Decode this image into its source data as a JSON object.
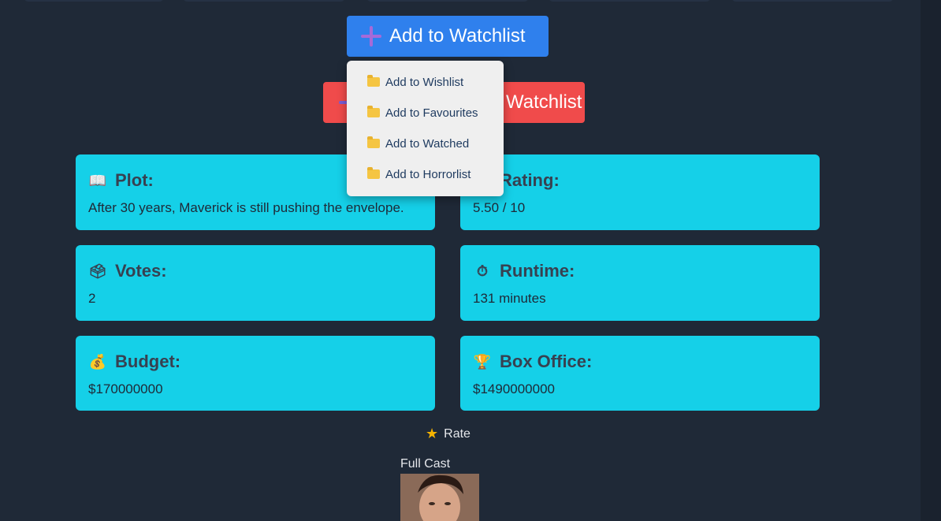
{
  "buttons": {
    "add_watchlist": "Add to Watchlist",
    "remove_watchlist": "Watchlist"
  },
  "menu": {
    "items": [
      {
        "label": "Add to Wishlist",
        "icon": "folder-icon"
      },
      {
        "label": "Add to Favourites",
        "icon": "folder-icon"
      },
      {
        "label": "Add to Watched",
        "icon": "folder-icon"
      },
      {
        "label": "Add to Horrorlist",
        "icon": "folder-icon"
      }
    ]
  },
  "cards": {
    "plot": {
      "title": "Plot:",
      "value": "After 30 years, Maverick is still pushing the envelope.",
      "icon": "book-icon"
    },
    "rating": {
      "title": "Rating:",
      "value": "5.50 / 10",
      "icon": "star-icon"
    },
    "votes": {
      "title": "Votes:",
      "value": "2",
      "icon": "ballot-box-icon"
    },
    "runtime": {
      "title": "Runtime:",
      "value": "131 minutes",
      "icon": "stopwatch-icon"
    },
    "budget": {
      "title": "Budget:",
      "value": "$170000000",
      "icon": "money-bag-icon"
    },
    "box_office": {
      "title": "Box Office:",
      "value": "$1490000000",
      "icon": "trophy-icon"
    }
  },
  "rate": {
    "label": "Rate",
    "icon": "star-icon"
  },
  "cast": {
    "label": "Full Cast"
  },
  "colors": {
    "background": "#1f2937",
    "card": "#15d0e8",
    "add_button": "#2f80ed",
    "remove_button": "#f04b4b",
    "menu": "#efefef"
  }
}
